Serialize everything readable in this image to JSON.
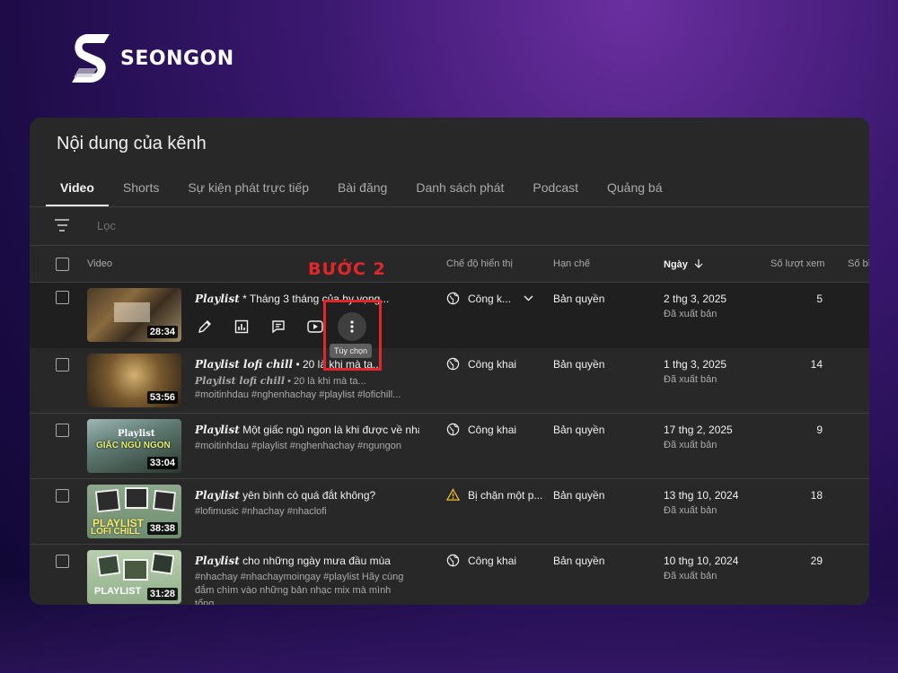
{
  "brand": {
    "name": "SEONGON"
  },
  "page": {
    "title": "Nội dung của kênh"
  },
  "tabs": [
    {
      "label": "Video",
      "active": true
    },
    {
      "label": "Shorts"
    },
    {
      "label": "Sự kiện phát trực tiếp"
    },
    {
      "label": "Bài đăng"
    },
    {
      "label": "Danh sách phát"
    },
    {
      "label": "Podcast"
    },
    {
      "label": "Quảng bá"
    }
  ],
  "filter": {
    "placeholder": "Lọc"
  },
  "columns": {
    "video": "Video",
    "visibility": "Chế độ hiển thị",
    "restrictions": "Hạn chế",
    "date": "Ngày",
    "views": "Số lượt xem",
    "comments": "Số bì"
  },
  "annotation": {
    "step_label": "BƯỚC 2",
    "color": "#e3262a"
  },
  "tooltip": "Tùy chọn",
  "rows": [
    {
      "duration": "28:34",
      "title_prefix": "Playlist",
      "title_rest": " * Tháng 3 tháng của hy vọng...",
      "visibility": "Công k...",
      "restriction": "Bản quyền",
      "date": "2 thg 3, 2025",
      "status": "Đã xuất bản",
      "views": "5"
    },
    {
      "duration": "53:56",
      "title_prefix": "Playlist lofi chill",
      "title_rest": " • 20 là khi mà ta...",
      "desc_prefix": "Playlist lofi chill",
      "desc_rest": " • 20 là khi mà ta...",
      "desc_line2": "#moitinhdau #nghenhachay #playlist #lofichill...",
      "visibility": "Công khai",
      "restriction": "Bản quyền",
      "date": "1 thg 3, 2025",
      "status": "Đã xuất bản",
      "views": "14"
    },
    {
      "duration": "33:04",
      "thumb_text_top": "Playlist",
      "thumb_text_main": "GIẤC NGỦ NGON",
      "title_prefix": "Playlist",
      "title_rest": " Một giấc ngủ ngon là khi được về nhà",
      "desc_line1": "#moitinhdau #playlist #nghenhachay #ngungon",
      "visibility": "Công khai",
      "restriction": "Bản quyền",
      "date": "17 thg 2, 2025",
      "status": "Đã xuất bản",
      "views": "9"
    },
    {
      "duration": "38:38",
      "thumb_text_main": "PLAYLIST",
      "thumb_text_sub": "LOFI CHILL",
      "title_prefix": "Playlist",
      "title_rest": " yên bình có quá đắt không?",
      "desc_line1": "#lofimusic #nhachay #nhaclofi",
      "visibility": "Bị chặn một p...",
      "visibility_icon": "warning-icon",
      "restriction": "Bản quyền",
      "date": "13 thg 10, 2024",
      "status": "Đã xuất bản",
      "views": "18"
    },
    {
      "duration": "31:28",
      "thumb_text_main": "PLAYLIST",
      "title_prefix": "Playlist",
      "title_rest": " cho những ngày mưa đầu mùa",
      "desc_line1": "#nhachay #nhachaymoingay #playlist Hãy cùng",
      "desc_line2": "đắm chìm vào những bản nhạc mix mà mình tổng...",
      "visibility": "Công khai",
      "restriction": "Bản quyền",
      "date": "10 thg 10, 2024",
      "status": "Đã xuất bản",
      "views": "29"
    }
  ]
}
